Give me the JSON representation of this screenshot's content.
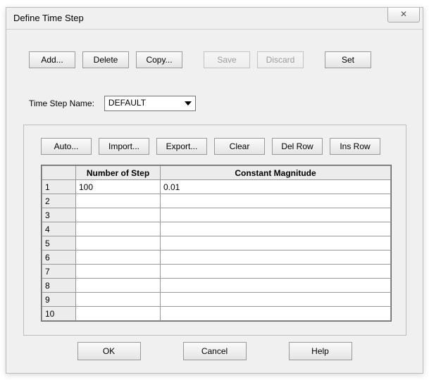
{
  "window": {
    "title": "Define Time Step",
    "close_glyph": "✕"
  },
  "top_buttons": {
    "add": {
      "label": "Add...",
      "enabled": true
    },
    "delete": {
      "label": "Delete",
      "enabled": true
    },
    "copy": {
      "label": "Copy...",
      "enabled": true
    },
    "save": {
      "label": "Save",
      "enabled": false
    },
    "discard": {
      "label": "Discard",
      "enabled": false
    },
    "set": {
      "label": "Set",
      "enabled": true
    }
  },
  "name_row": {
    "label": "Time Step Name:",
    "value": "DEFAULT"
  },
  "grid_buttons": {
    "auto": "Auto...",
    "import": "Import...",
    "export": "Export...",
    "clear": "Clear",
    "delrow": "Del Row",
    "insrow": "Ins Row"
  },
  "grid": {
    "headers": {
      "steps": "Number of Step",
      "mag": "Constant Magnitude"
    },
    "rows": [
      {
        "n": "1",
        "steps": "100",
        "mag": "0.01"
      },
      {
        "n": "2",
        "steps": "",
        "mag": ""
      },
      {
        "n": "3",
        "steps": "",
        "mag": ""
      },
      {
        "n": "4",
        "steps": "",
        "mag": ""
      },
      {
        "n": "5",
        "steps": "",
        "mag": ""
      },
      {
        "n": "6",
        "steps": "",
        "mag": ""
      },
      {
        "n": "7",
        "steps": "",
        "mag": ""
      },
      {
        "n": "8",
        "steps": "",
        "mag": ""
      },
      {
        "n": "9",
        "steps": "",
        "mag": ""
      },
      {
        "n": "10",
        "steps": "",
        "mag": ""
      }
    ]
  },
  "bottom_buttons": {
    "ok": "OK",
    "cancel": "Cancel",
    "help": "Help"
  }
}
